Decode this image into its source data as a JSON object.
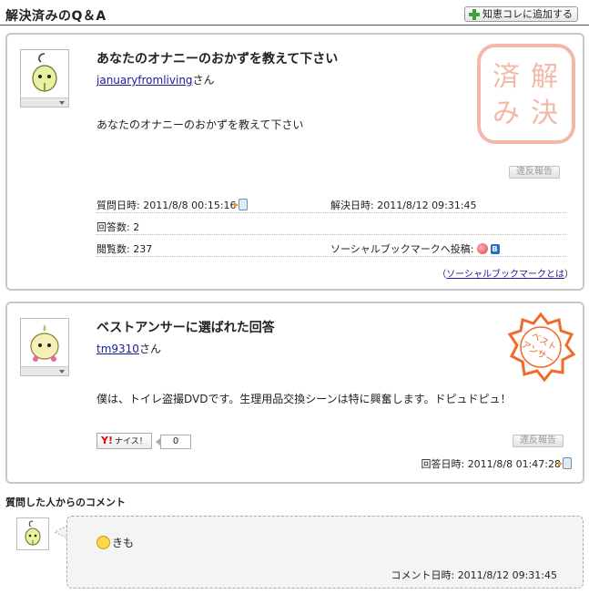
{
  "header": {
    "title": "解決済みのQ＆A",
    "add_button": "知恵コレに追加する"
  },
  "question": {
    "title": "あなたのオナニーのおかずを教えて下さい",
    "user": "januaryfromliving",
    "honorific": "さん",
    "body": "あなたのオナニーのおかずを教えて下さい",
    "report_button": "違反報告",
    "stamp": "解決済み",
    "meta": {
      "asked_label": "質問日時:",
      "asked_value": "2011/8/8 00:15:16",
      "resolved_label": "解決日時:",
      "resolved_value": "2011/8/12 09:31:45",
      "answers_label": "回答数:",
      "answers_value": "2",
      "views_label": "閲覧数:",
      "views_value": "237",
      "social_label": "ソーシャルブックマークへ投稿:",
      "social_link_open": "（",
      "social_link": "ソーシャルブックマークとは",
      "social_link_close": "）"
    }
  },
  "best_answer": {
    "title": "ベストアンサーに選ばれた回答",
    "user": "tm9310",
    "honorific": "さん",
    "body": "僕は、トイレ盗撮DVDです。生理用品交換シーンは特に興奮します。ドピュドピュ！",
    "nice_label": "ナイス！",
    "nice_brand": "Y!",
    "nice_count": "0",
    "report_button": "違反報告",
    "stamp": "ベストアンサー",
    "time_label": "回答日時:",
    "time_value": "2011/8/8 01:47:28"
  },
  "comment": {
    "heading": "質問した人からのコメント",
    "text": "きも",
    "time_label": "コメント日時:",
    "time_value": "2011/8/12 09:31:45"
  },
  "colors": {
    "stamp_solved": "#f4b8a8",
    "stamp_best": "#f26a2a",
    "link": "#1a1a99",
    "panel_border": "#c8c8c8"
  }
}
